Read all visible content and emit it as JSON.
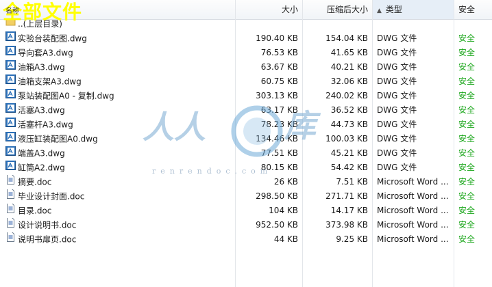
{
  "overlay_title": "全部文件",
  "header": {
    "name": "名称",
    "size": "大小",
    "compressed_size": "压缩后大小",
    "type": "类型",
    "safety": "安全"
  },
  "watermark": {
    "left_text": "人人",
    "right_text": "库",
    "url": "renrendoc.com"
  },
  "rows": [
    {
      "name": "..(上层目录)",
      "icon": "folder-icon",
      "size": "",
      "csize": "",
      "type": "",
      "safe": ""
    },
    {
      "name": "实验台装配图.dwg",
      "icon": "dwg-file-icon",
      "size": "190.40 KB",
      "csize": "154.04 KB",
      "type": "DWG 文件",
      "safe": "安全"
    },
    {
      "name": "导向套A3.dwg",
      "icon": "dwg-file-icon",
      "size": "76.53 KB",
      "csize": "41.65 KB",
      "type": "DWG 文件",
      "safe": "安全"
    },
    {
      "name": "油箱A3.dwg",
      "icon": "dwg-file-icon",
      "size": "63.67 KB",
      "csize": "40.21 KB",
      "type": "DWG 文件",
      "safe": "安全"
    },
    {
      "name": "油箱支架A3.dwg",
      "icon": "dwg-file-icon",
      "size": "60.75 KB",
      "csize": "32.06 KB",
      "type": "DWG 文件",
      "safe": "安全"
    },
    {
      "name": "泵站装配图A0 - 复制.dwg",
      "icon": "dwg-file-icon",
      "size": "303.13 KB",
      "csize": "240.02 KB",
      "type": "DWG 文件",
      "safe": "安全"
    },
    {
      "name": "活塞A3.dwg",
      "icon": "dwg-file-icon",
      "size": "63.17 KB",
      "csize": "36.52 KB",
      "type": "DWG 文件",
      "safe": "安全"
    },
    {
      "name": "活塞杆A3.dwg",
      "icon": "dwg-file-icon",
      "size": "78.23 KB",
      "csize": "44.73 KB",
      "type": "DWG 文件",
      "safe": "安全"
    },
    {
      "name": "液压缸装配图A0.dwg",
      "icon": "dwg-file-icon",
      "size": "134.46 KB",
      "csize": "100.03 KB",
      "type": "DWG 文件",
      "safe": "安全"
    },
    {
      "name": "端盖A3.dwg",
      "icon": "dwg-file-icon",
      "size": "77.51 KB",
      "csize": "45.21 KB",
      "type": "DWG 文件",
      "safe": "安全"
    },
    {
      "name": "缸筒A2.dwg",
      "icon": "dwg-file-icon",
      "size": "80.15 KB",
      "csize": "54.42 KB",
      "type": "DWG 文件",
      "safe": "安全"
    },
    {
      "name": "摘要.doc",
      "icon": "doc-file-icon",
      "size": "26 KB",
      "csize": "7.51 KB",
      "type": "Microsoft Word ...",
      "safe": "安全"
    },
    {
      "name": "毕业设计封面.doc",
      "icon": "doc-file-icon",
      "size": "298.50 KB",
      "csize": "271.71 KB",
      "type": "Microsoft Word ...",
      "safe": "安全"
    },
    {
      "name": "目录.doc",
      "icon": "doc-file-icon",
      "size": "104 KB",
      "csize": "14.17 KB",
      "type": "Microsoft Word ...",
      "safe": "安全"
    },
    {
      "name": "设计说明书.doc",
      "icon": "doc-file-icon",
      "size": "952.50 KB",
      "csize": "373.98 KB",
      "type": "Microsoft Word ...",
      "safe": "安全"
    },
    {
      "name": "说明书扉页.doc",
      "icon": "doc-file-icon",
      "size": "44 KB",
      "csize": "9.25 KB",
      "type": "Microsoft Word ...",
      "safe": "安全"
    }
  ]
}
